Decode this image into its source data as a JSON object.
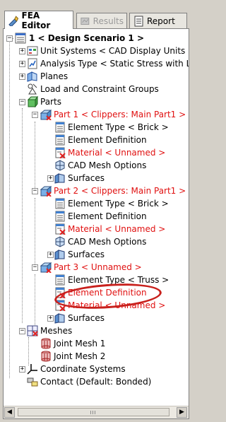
{
  "tabs": [
    {
      "label": "FEA Editor",
      "active": true,
      "icon": "fea-editor-icon"
    },
    {
      "label": "Results",
      "active": false,
      "disabled": true,
      "icon": "results-icon"
    },
    {
      "label": "Report",
      "active": false,
      "icon": "report-icon"
    }
  ],
  "tree": {
    "root": "1 < Design Scenario 1 >",
    "unit_systems": "Unit Systems < CAD Display Units >",
    "analysis_type": "Analysis Type < Static Stress with Lir",
    "planes": "Planes",
    "load_groups": "Load and Constraint Groups",
    "parts": "Parts",
    "part1": {
      "label": "Part 1 < Clippers: Main Part1 >",
      "element_type": "Element Type < Brick >",
      "element_definition": "Element Definition",
      "material": "Material < Unnamed >",
      "cad_mesh": "CAD Mesh Options",
      "surfaces": "Surfaces"
    },
    "part2": {
      "label": "Part 2 < Clippers: Main Part1 >",
      "element_type": "Element Type < Brick >",
      "element_definition": "Element Definition",
      "material": "Material < Unnamed >",
      "cad_mesh": "CAD Mesh Options",
      "surfaces": "Surfaces"
    },
    "part3": {
      "label": "Part 3 < Unnamed >",
      "element_type": "Element Type < Truss >",
      "element_definition": "Element Definition",
      "material": "Material < Unnamed >",
      "surfaces": "Surfaces"
    },
    "meshes": "Meshes",
    "joint_mesh1": "Joint Mesh 1",
    "joint_mesh2": "Joint Mesh 2",
    "coordinate_systems": "Coordinate Systems",
    "contact": "Contact (Default: Bonded)"
  },
  "colors": {
    "error_text": "#e01010",
    "highlight_oval": "#c8201c"
  }
}
